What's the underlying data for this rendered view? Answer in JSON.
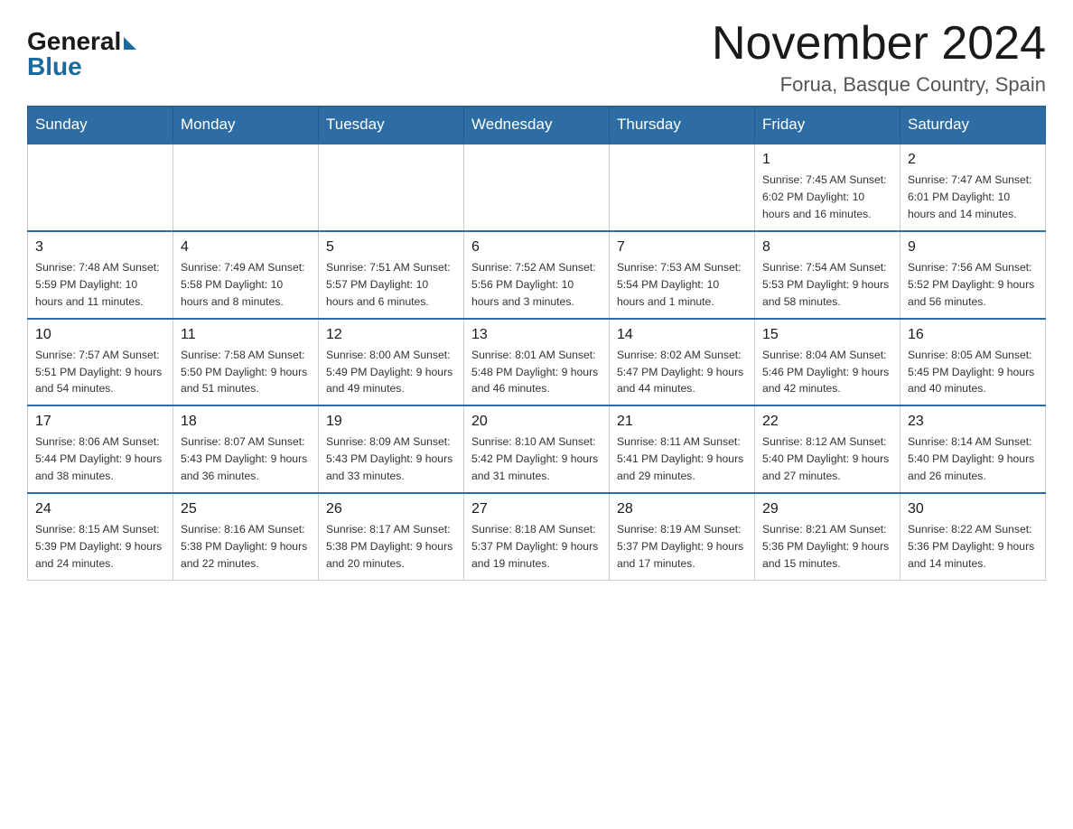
{
  "logo": {
    "general": "General",
    "blue": "Blue"
  },
  "title": "November 2024",
  "location": "Forua, Basque Country, Spain",
  "days_of_week": [
    "Sunday",
    "Monday",
    "Tuesday",
    "Wednesday",
    "Thursday",
    "Friday",
    "Saturday"
  ],
  "weeks": [
    [
      {
        "day": "",
        "info": ""
      },
      {
        "day": "",
        "info": ""
      },
      {
        "day": "",
        "info": ""
      },
      {
        "day": "",
        "info": ""
      },
      {
        "day": "",
        "info": ""
      },
      {
        "day": "1",
        "info": "Sunrise: 7:45 AM\nSunset: 6:02 PM\nDaylight: 10 hours\nand 16 minutes."
      },
      {
        "day": "2",
        "info": "Sunrise: 7:47 AM\nSunset: 6:01 PM\nDaylight: 10 hours\nand 14 minutes."
      }
    ],
    [
      {
        "day": "3",
        "info": "Sunrise: 7:48 AM\nSunset: 5:59 PM\nDaylight: 10 hours\nand 11 minutes."
      },
      {
        "day": "4",
        "info": "Sunrise: 7:49 AM\nSunset: 5:58 PM\nDaylight: 10 hours\nand 8 minutes."
      },
      {
        "day": "5",
        "info": "Sunrise: 7:51 AM\nSunset: 5:57 PM\nDaylight: 10 hours\nand 6 minutes."
      },
      {
        "day": "6",
        "info": "Sunrise: 7:52 AM\nSunset: 5:56 PM\nDaylight: 10 hours\nand 3 minutes."
      },
      {
        "day": "7",
        "info": "Sunrise: 7:53 AM\nSunset: 5:54 PM\nDaylight: 10 hours\nand 1 minute."
      },
      {
        "day": "8",
        "info": "Sunrise: 7:54 AM\nSunset: 5:53 PM\nDaylight: 9 hours\nand 58 minutes."
      },
      {
        "day": "9",
        "info": "Sunrise: 7:56 AM\nSunset: 5:52 PM\nDaylight: 9 hours\nand 56 minutes."
      }
    ],
    [
      {
        "day": "10",
        "info": "Sunrise: 7:57 AM\nSunset: 5:51 PM\nDaylight: 9 hours\nand 54 minutes."
      },
      {
        "day": "11",
        "info": "Sunrise: 7:58 AM\nSunset: 5:50 PM\nDaylight: 9 hours\nand 51 minutes."
      },
      {
        "day": "12",
        "info": "Sunrise: 8:00 AM\nSunset: 5:49 PM\nDaylight: 9 hours\nand 49 minutes."
      },
      {
        "day": "13",
        "info": "Sunrise: 8:01 AM\nSunset: 5:48 PM\nDaylight: 9 hours\nand 46 minutes."
      },
      {
        "day": "14",
        "info": "Sunrise: 8:02 AM\nSunset: 5:47 PM\nDaylight: 9 hours\nand 44 minutes."
      },
      {
        "day": "15",
        "info": "Sunrise: 8:04 AM\nSunset: 5:46 PM\nDaylight: 9 hours\nand 42 minutes."
      },
      {
        "day": "16",
        "info": "Sunrise: 8:05 AM\nSunset: 5:45 PM\nDaylight: 9 hours\nand 40 minutes."
      }
    ],
    [
      {
        "day": "17",
        "info": "Sunrise: 8:06 AM\nSunset: 5:44 PM\nDaylight: 9 hours\nand 38 minutes."
      },
      {
        "day": "18",
        "info": "Sunrise: 8:07 AM\nSunset: 5:43 PM\nDaylight: 9 hours\nand 36 minutes."
      },
      {
        "day": "19",
        "info": "Sunrise: 8:09 AM\nSunset: 5:43 PM\nDaylight: 9 hours\nand 33 minutes."
      },
      {
        "day": "20",
        "info": "Sunrise: 8:10 AM\nSunset: 5:42 PM\nDaylight: 9 hours\nand 31 minutes."
      },
      {
        "day": "21",
        "info": "Sunrise: 8:11 AM\nSunset: 5:41 PM\nDaylight: 9 hours\nand 29 minutes."
      },
      {
        "day": "22",
        "info": "Sunrise: 8:12 AM\nSunset: 5:40 PM\nDaylight: 9 hours\nand 27 minutes."
      },
      {
        "day": "23",
        "info": "Sunrise: 8:14 AM\nSunset: 5:40 PM\nDaylight: 9 hours\nand 26 minutes."
      }
    ],
    [
      {
        "day": "24",
        "info": "Sunrise: 8:15 AM\nSunset: 5:39 PM\nDaylight: 9 hours\nand 24 minutes."
      },
      {
        "day": "25",
        "info": "Sunrise: 8:16 AM\nSunset: 5:38 PM\nDaylight: 9 hours\nand 22 minutes."
      },
      {
        "day": "26",
        "info": "Sunrise: 8:17 AM\nSunset: 5:38 PM\nDaylight: 9 hours\nand 20 minutes."
      },
      {
        "day": "27",
        "info": "Sunrise: 8:18 AM\nSunset: 5:37 PM\nDaylight: 9 hours\nand 19 minutes."
      },
      {
        "day": "28",
        "info": "Sunrise: 8:19 AM\nSunset: 5:37 PM\nDaylight: 9 hours\nand 17 minutes."
      },
      {
        "day": "29",
        "info": "Sunrise: 8:21 AM\nSunset: 5:36 PM\nDaylight: 9 hours\nand 15 minutes."
      },
      {
        "day": "30",
        "info": "Sunrise: 8:22 AM\nSunset: 5:36 PM\nDaylight: 9 hours\nand 14 minutes."
      }
    ]
  ]
}
